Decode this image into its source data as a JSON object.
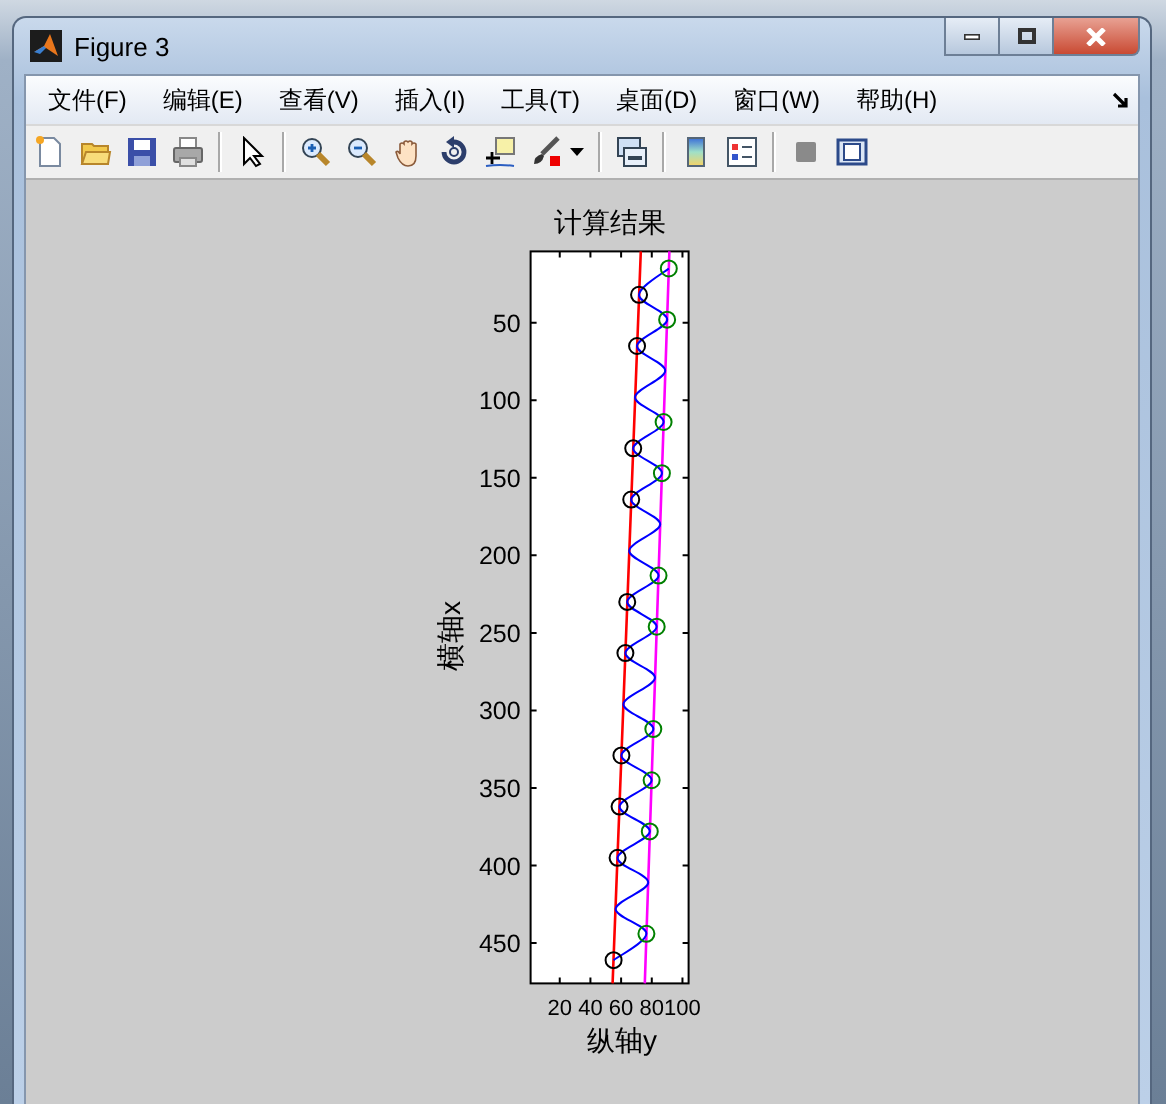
{
  "window": {
    "title": "Figure 3"
  },
  "menu": [
    {
      "label": "文件(F)"
    },
    {
      "label": "编辑(E)"
    },
    {
      "label": "查看(V)"
    },
    {
      "label": "插入(I)"
    },
    {
      "label": "工具(T)"
    },
    {
      "label": "桌面(D)"
    },
    {
      "label": "窗口(W)"
    },
    {
      "label": "帮助(H)"
    }
  ],
  "figure": {
    "chart_data": {
      "type": "line",
      "title": "计算结果",
      "xlabel": "纵轴y",
      "ylabel": "横轴x",
      "xlim": [
        1,
        104
      ],
      "ylim": [
        476,
        4
      ],
      "xticks": [
        20,
        40,
        60,
        80,
        100
      ],
      "yticks": [
        50,
        100,
        150,
        200,
        250,
        300,
        350,
        400,
        450
      ],
      "series": [
        {
          "type": "line",
          "color": "#ff0000",
          "x": [
            72.9,
            54.5
          ],
          "values": [
            4,
            476
          ]
        },
        {
          "type": "line",
          "color": "#ff00ff",
          "x": [
            91.5,
            75.4
          ],
          "values": [
            4,
            476
          ]
        },
        {
          "type": "line",
          "color": "#0000ff",
          "x": [
            91.1,
            71.7,
            90.0,
            70.4,
            88.8,
            69.1,
            87.7,
            67.9,
            86.6,
            66.6,
            85.5,
            65.3,
            84.4,
            64.0,
            83.2,
            62.8,
            82.1,
            61.5,
            81.0,
            60.2,
            79.9,
            59.0,
            78.7,
            57.7,
            77.6,
            56.4,
            76.5,
            55.1
          ],
          "values": [
            15,
            32,
            48,
            65,
            81,
            98,
            114,
            131,
            147,
            164,
            180,
            197,
            213,
            230,
            246,
            263,
            279,
            296,
            312,
            329,
            345,
            362,
            378,
            395,
            411,
            428,
            444,
            461
          ]
        },
        {
          "type": "scatter",
          "color": "#008000",
          "x": [
            91.1,
            90.0,
            87.7,
            86.6,
            84.4,
            83.2,
            81.0,
            79.9,
            78.7,
            76.5
          ],
          "values": [
            15,
            48,
            114,
            147,
            213,
            246,
            312,
            345,
            378,
            444
          ]
        },
        {
          "type": "scatter",
          "color": "#000000",
          "x": [
            71.7,
            70.4,
            67.9,
            66.6,
            64.0,
            62.8,
            60.2,
            59.0,
            57.7,
            55.1
          ],
          "values": [
            32,
            65,
            131,
            164,
            230,
            263,
            329,
            362,
            395,
            461
          ]
        }
      ]
    }
  }
}
